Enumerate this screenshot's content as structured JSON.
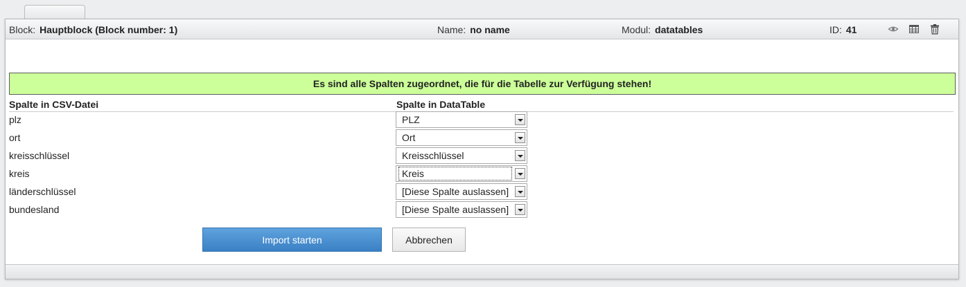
{
  "header": {
    "block_label": "Block:",
    "block_value": "Hauptblock (Block number: 1)",
    "name_label": "Name:",
    "name_value": "no name",
    "modul_label": "Modul:",
    "modul_value": "datatables",
    "id_label": "ID:",
    "id_value": "41",
    "icons": [
      "eye-icon",
      "table-icon",
      "trash-icon"
    ]
  },
  "notice": "Es sind alle Spalten zugeordnet, die für die Tabelle zur Verfügung stehen!",
  "columns": {
    "csv": "Spalte in CSV-Datei",
    "datatable": "Spalte in DataTable"
  },
  "mapping": [
    {
      "csv": "plz",
      "selected": "PLZ"
    },
    {
      "csv": "ort",
      "selected": "Ort"
    },
    {
      "csv": "kreisschlüssel",
      "selected": "Kreisschlüssel"
    },
    {
      "csv": "kreis",
      "selected": "Kreis"
    },
    {
      "csv": "länderschlüssel",
      "selected": "[Diese Spalte auslassen]"
    },
    {
      "csv": "bundesland",
      "selected": "[Diese Spalte auslassen]"
    }
  ],
  "buttons": {
    "import": "Import starten",
    "cancel": "Abbrechen"
  },
  "colors": {
    "notice_bg": "#ccff99",
    "primary_btn": "#4a90d2"
  }
}
